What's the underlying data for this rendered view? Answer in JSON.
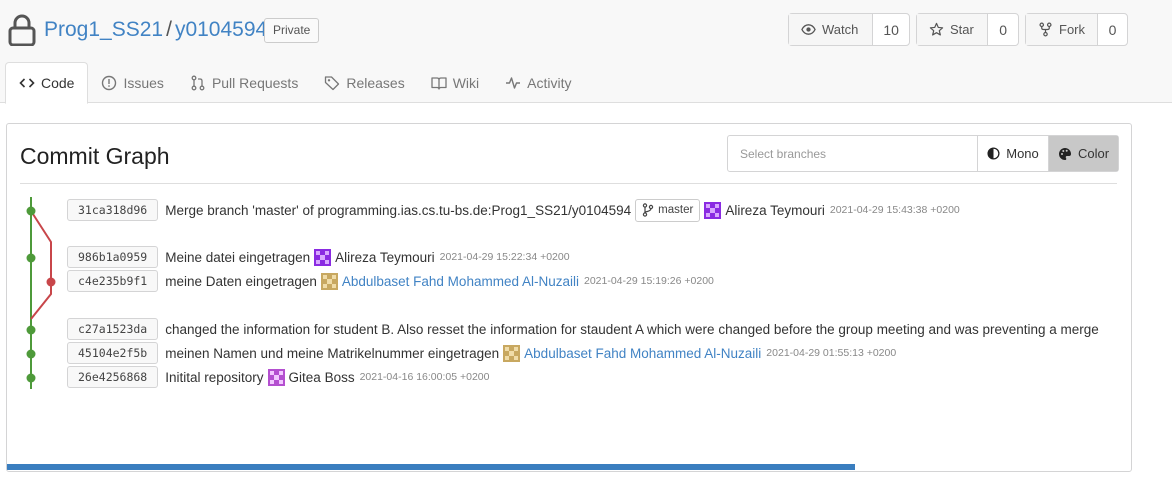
{
  "repo": {
    "owner": "Prog1_SS21",
    "separator": "/",
    "name": "y0104594",
    "visibility": "Private"
  },
  "actions": {
    "watch": {
      "label": "Watch",
      "count": "10"
    },
    "star": {
      "label": "Star",
      "count": "0"
    },
    "fork": {
      "label": "Fork",
      "count": "0"
    }
  },
  "tabs": [
    {
      "label": "Code",
      "icon": "code-icon",
      "active": true
    },
    {
      "label": "Issues",
      "icon": "issue-icon"
    },
    {
      "label": "Pull Requests",
      "icon": "pull-request-icon"
    },
    {
      "label": "Releases",
      "icon": "tag-icon"
    },
    {
      "label": "Wiki",
      "icon": "book-icon"
    },
    {
      "label": "Activity",
      "icon": "pulse-icon"
    }
  ],
  "graph_page": {
    "title": "Commit Graph",
    "select_placeholder": "Select branches",
    "mono_label": "Mono",
    "color_label": "Color"
  },
  "commits": [
    {
      "sha": "31ca318d96",
      "message": "Merge branch 'master' of programming.ias.cs.tu-bs.de:Prog1_SS21/y0104594",
      "ref": "master",
      "author": "Alireza Teymouri",
      "author_link": false,
      "time": "2021-04-29 15:43:38 +0200",
      "avatar_color": "#8a2be2"
    },
    {
      "sha": "986b1a0959",
      "message": "Meine datei eingetragen",
      "author": "Alireza Teymouri",
      "author_link": false,
      "time": "2021-04-29 15:22:34 +0200",
      "avatar_color": "#8a2be2"
    },
    {
      "sha": "c4e235b9f1",
      "message": "meine Daten eingetragen",
      "author": "Abdulbaset Fahd Mohammed Al-Nuzaili",
      "author_link": true,
      "time": "2021-04-29 15:19:26 +0200",
      "avatar_color": "#c8a860"
    },
    {
      "sha": "c27a1523da",
      "message": "changed the information for student B. Also resset the information for staudent A which were changed before the group meeting and was preventing a merge",
      "author": "",
      "author_link": false,
      "time": "",
      "avatar_color": ""
    },
    {
      "sha": "45104e2f5b",
      "message": "meinen Namen und meine Matrikelnummer eingetragen",
      "author": "Abdulbaset Fahd Mohammed Al-Nuzaili",
      "author_link": true,
      "time": "2021-04-29 01:55:13 +0200",
      "avatar_color": "#c8a860"
    },
    {
      "sha": "26e4256868",
      "message": "Initital repository",
      "author": "Gitea Boss",
      "author_link": false,
      "time": "2021-04-16 16:00:05 +0200",
      "avatar_color": "#b44fd0"
    }
  ],
  "colors": {
    "link": "#4183c4",
    "branch_main": "#4e9a3a",
    "branch_side": "#c8464a",
    "progress": "#3a7ebf"
  }
}
